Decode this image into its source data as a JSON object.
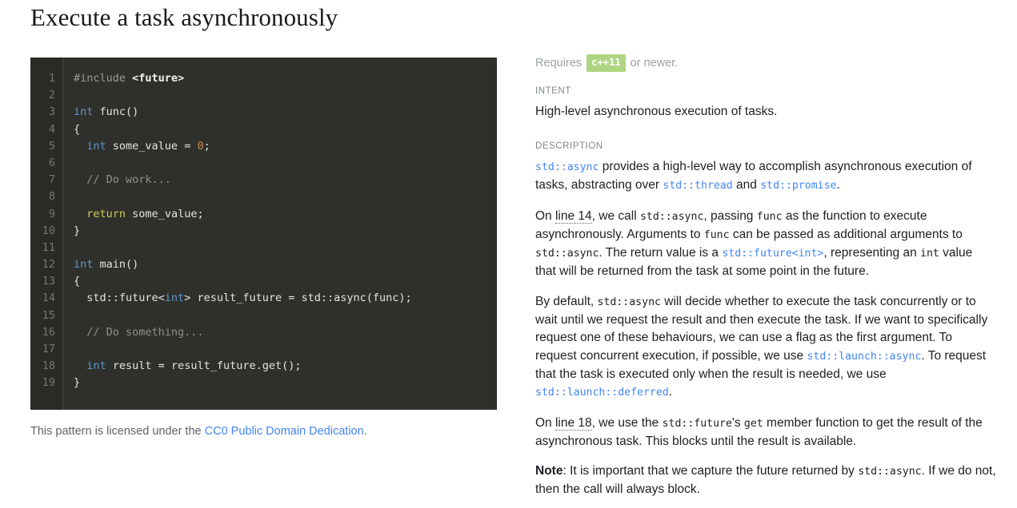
{
  "title": "Execute a task asynchronously",
  "code": {
    "language": "cpp",
    "lines": [
      {
        "n": "1",
        "tokens": [
          {
            "t": "#include ",
            "c": "pre"
          },
          {
            "t": "<future>",
            "c": "inc"
          }
        ]
      },
      {
        "n": "2",
        "tokens": []
      },
      {
        "n": "3",
        "tokens": [
          {
            "t": "int",
            "c": "kw"
          },
          {
            "t": " func()",
            "c": "pln"
          }
        ]
      },
      {
        "n": "4",
        "tokens": [
          {
            "t": "{",
            "c": "pln"
          }
        ]
      },
      {
        "n": "5",
        "tokens": [
          {
            "t": "  ",
            "c": "pln"
          },
          {
            "t": "int",
            "c": "kw"
          },
          {
            "t": " some_value = ",
            "c": "pln"
          },
          {
            "t": "0",
            "c": "num"
          },
          {
            "t": ";",
            "c": "pln"
          }
        ]
      },
      {
        "n": "6",
        "tokens": []
      },
      {
        "n": "7",
        "tokens": [
          {
            "t": "  // Do work...",
            "c": "cmt"
          }
        ]
      },
      {
        "n": "8",
        "tokens": []
      },
      {
        "n": "9",
        "tokens": [
          {
            "t": "  ",
            "c": "pln"
          },
          {
            "t": "return",
            "c": "ret"
          },
          {
            "t": " some_value;",
            "c": "pln"
          }
        ]
      },
      {
        "n": "10",
        "tokens": [
          {
            "t": "}",
            "c": "pln"
          }
        ]
      },
      {
        "n": "11",
        "tokens": []
      },
      {
        "n": "12",
        "tokens": [
          {
            "t": "int",
            "c": "kw"
          },
          {
            "t": " main()",
            "c": "pln"
          }
        ]
      },
      {
        "n": "13",
        "tokens": [
          {
            "t": "{",
            "c": "pln"
          }
        ]
      },
      {
        "n": "14",
        "tokens": [
          {
            "t": "  std::future<",
            "c": "pln"
          },
          {
            "t": "int",
            "c": "kw"
          },
          {
            "t": "> result_future = std::async(func);",
            "c": "pln"
          }
        ]
      },
      {
        "n": "15",
        "tokens": []
      },
      {
        "n": "16",
        "tokens": [
          {
            "t": "  // Do something...",
            "c": "cmt"
          }
        ]
      },
      {
        "n": "17",
        "tokens": []
      },
      {
        "n": "18",
        "tokens": [
          {
            "t": "  ",
            "c": "pln"
          },
          {
            "t": "int",
            "c": "kw"
          },
          {
            "t": " result = result_future.get();",
            "c": "pln"
          }
        ]
      },
      {
        "n": "19",
        "tokens": [
          {
            "t": "}",
            "c": "pln"
          }
        ]
      }
    ]
  },
  "license": {
    "prefix": "This pattern is licensed under the ",
    "link_text": "CC0 Public Domain Dedication",
    "suffix": "."
  },
  "requires": {
    "prefix": "Requires",
    "badge": "c++11",
    "suffix": "or newer."
  },
  "intent": {
    "label": "Intent",
    "text": "High-level asynchronous execution of tasks."
  },
  "description": {
    "label": "Description",
    "paragraphs": [
      {
        "id": "p1",
        "runs": [
          {
            "t": "std::async",
            "k": "code-link"
          },
          {
            "t": " provides a high-level way to accomplish asynchronous execution of tasks, abstracting over ",
            "k": "text"
          },
          {
            "t": "std::thread",
            "k": "code-link"
          },
          {
            "t": " and ",
            "k": "text"
          },
          {
            "t": "std::promise",
            "k": "code-link"
          },
          {
            "t": ".",
            "k": "text"
          }
        ]
      },
      {
        "id": "p2",
        "runs": [
          {
            "t": "On ",
            "k": "text"
          },
          {
            "t": "line 14",
            "k": "line-ref"
          },
          {
            "t": ", we call ",
            "k": "text"
          },
          {
            "t": "std::async",
            "k": "code-plain"
          },
          {
            "t": ", passing ",
            "k": "text"
          },
          {
            "t": "func",
            "k": "code-plain"
          },
          {
            "t": " as the function to execute asynchronously. Arguments to ",
            "k": "text"
          },
          {
            "t": "func",
            "k": "code-plain"
          },
          {
            "t": " can be passed as additional arguments to ",
            "k": "text"
          },
          {
            "t": "std::async",
            "k": "code-plain"
          },
          {
            "t": ". The return value is a ",
            "k": "text"
          },
          {
            "t": "std::future<int>",
            "k": "code-link"
          },
          {
            "t": ", representing an ",
            "k": "text"
          },
          {
            "t": "int",
            "k": "code-plain"
          },
          {
            "t": " value that will be returned from the task at some point in the future.",
            "k": "text"
          }
        ]
      },
      {
        "id": "p3",
        "runs": [
          {
            "t": "By default, ",
            "k": "text"
          },
          {
            "t": "std::async",
            "k": "code-plain"
          },
          {
            "t": " will decide whether to execute the task concurrently or to wait until we request the result and then execute the task. If we want to specifically request one of these behaviours, we can use a flag as the first argument. To request concurrent execution, if possible, we use ",
            "k": "text"
          },
          {
            "t": "std::launch::async",
            "k": "code-link"
          },
          {
            "t": ". To request that the task is executed only when the result is needed, we use ",
            "k": "text"
          },
          {
            "t": "std::launch::deferred",
            "k": "code-link"
          },
          {
            "t": ".",
            "k": "text"
          }
        ]
      },
      {
        "id": "p4",
        "runs": [
          {
            "t": "On ",
            "k": "text"
          },
          {
            "t": "line 18",
            "k": "line-ref"
          },
          {
            "t": ", we use the ",
            "k": "text"
          },
          {
            "t": "std::future",
            "k": "code-plain"
          },
          {
            "t": "'s ",
            "k": "text"
          },
          {
            "t": "get",
            "k": "code-plain"
          },
          {
            "t": " member function to get the result of the asynchronous task. This blocks until the result is available.",
            "k": "text"
          }
        ]
      },
      {
        "id": "p5",
        "runs": [
          {
            "t": "Note",
            "k": "bold"
          },
          {
            "t": ": It is important that we capture the future returned by ",
            "k": "text"
          },
          {
            "t": "std::async",
            "k": "code-plain"
          },
          {
            "t": ". If we do not, then the call will always block.",
            "k": "text"
          }
        ]
      }
    ]
  },
  "colors": {
    "link": "#4285f4",
    "badge_bg": "#aed581",
    "code_bg": "#2f302b",
    "gutter_bg": "#2a2b26",
    "muted": "#80868b"
  }
}
